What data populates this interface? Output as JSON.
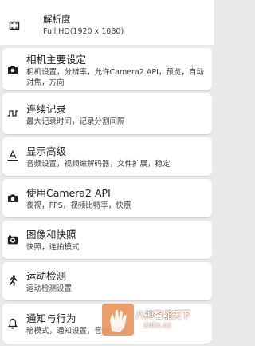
{
  "resolution": {
    "title": "解析度",
    "value": "Full HD(1920 x 1080)",
    "icon": "fullscreen-icon"
  },
  "items": [
    {
      "icon": "camera-icon",
      "title": "相机主要设定",
      "subtitle": "相机设置，分辨率，允许Camera2 API，预览，自动对焦，方向"
    },
    {
      "icon": "square-wave-icon",
      "title": "连续记录",
      "subtitle": "最大记录时间，记录分割间隔"
    },
    {
      "icon": "text-overlay-icon",
      "title": "显示高级",
      "subtitle": "音频设置，视频编解码器，文件扩展，稳定"
    },
    {
      "icon": "camera-icon",
      "title": "使用Camera2 API",
      "subtitle": "夜视，FPS，视频比特率，快照"
    },
    {
      "icon": "photo-camera-icon",
      "title": "图像和快照",
      "subtitle": "快照，连拍模式"
    },
    {
      "icon": "running-person-icon",
      "title": "运动检测",
      "subtitle": "运动检测设置"
    },
    {
      "icon": "bell-icon",
      "title": "通知与行为",
      "subtitle": "暗模式，通知设置，音频通知"
    }
  ],
  "watermark": {
    "icon": "hand-logo-icon",
    "text": "八神智能天下",
    "url": "zntx.cc"
  }
}
